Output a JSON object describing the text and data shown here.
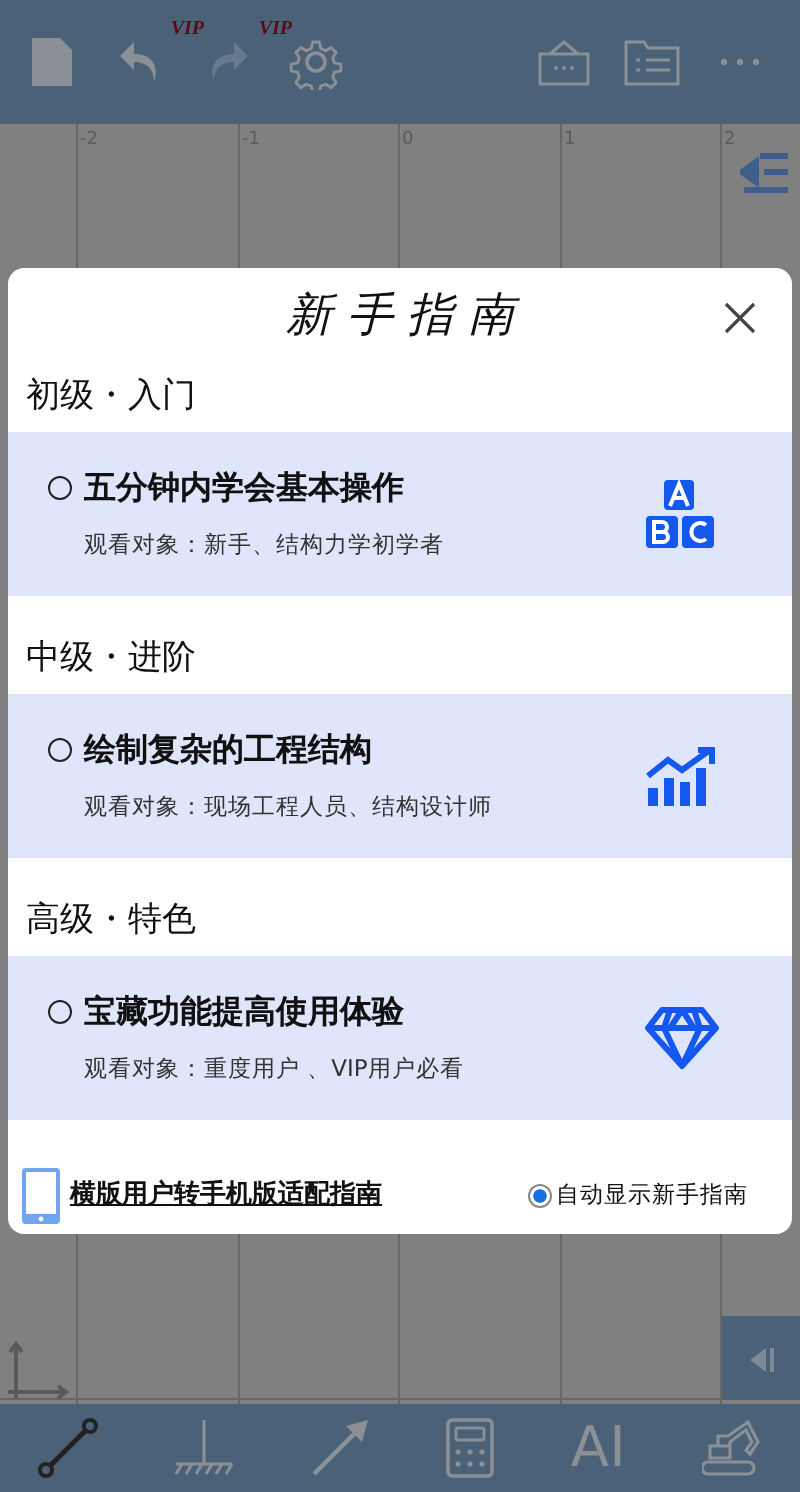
{
  "top_toolbar": [
    {
      "kind": "file",
      "disabled": false
    },
    {
      "kind": "undo",
      "badge": "VIP",
      "disabled": false
    },
    {
      "kind": "redo",
      "badge": "VIP",
      "disabled": true
    },
    {
      "kind": "settings",
      "disabled": false
    },
    {
      "kind": "inbox",
      "disabled": false
    },
    {
      "kind": "folder-list",
      "disabled": false
    },
    {
      "kind": "more",
      "disabled": false
    }
  ],
  "ruler_labels": [
    "-2",
    "-1",
    "0",
    "1",
    "2"
  ],
  "bottom_toolbar": [
    {
      "kind": "member",
      "selected": true
    },
    {
      "kind": "support",
      "selected": false
    },
    {
      "kind": "load",
      "selected": false
    },
    {
      "kind": "calculator",
      "selected": false
    },
    {
      "kind": "text",
      "label": "AI",
      "selected": false
    },
    {
      "kind": "excavator",
      "selected": false
    }
  ],
  "dialog": {
    "title": "新 手 指 南",
    "sections": [
      {
        "heading": "初级・入门",
        "item": {
          "title": "五分钟内学会基本操作",
          "audience": "观看对象：新手、结构力学初学者",
          "selected": false
        }
      },
      {
        "heading": "中级・进阶",
        "item": {
          "title": "绘制复杂的工程结构",
          "audience": "观看对象：现场工程人员、结构设计师",
          "selected": false
        }
      },
      {
        "heading": "高级・特色",
        "item": {
          "title": "宝藏功能提高使用体验",
          "audience": "观看对象：重度用户 、VIP用户必看",
          "selected": false
        }
      }
    ],
    "footer": {
      "link": "横版用户转手机版适配指南",
      "option": {
        "label": "自动显示新手指南",
        "checked": true
      }
    }
  }
}
